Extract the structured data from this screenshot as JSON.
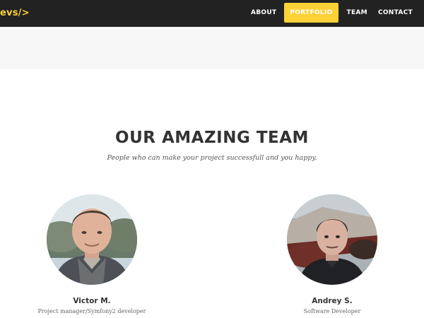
{
  "header": {
    "brand": "evs/>",
    "nav": [
      {
        "label": "ABOUT"
      },
      {
        "label": "PORTFOLIO",
        "active": true
      },
      {
        "label": "TEAM"
      },
      {
        "label": "CONTACT"
      }
    ]
  },
  "team": {
    "title": "OUR AMAZING TEAM",
    "subtitle": "People who can make your project successfull and you happy.",
    "members": [
      {
        "name": "Victor M.",
        "role": "Project manager/Symfony2 developer"
      },
      {
        "name": "Andrey S.",
        "role": "Software Developer"
      }
    ]
  },
  "colors": {
    "navbar_bg": "#222222",
    "accent": "#fed136",
    "band_bg": "#f7f7f7",
    "text_dark": "#333333"
  }
}
